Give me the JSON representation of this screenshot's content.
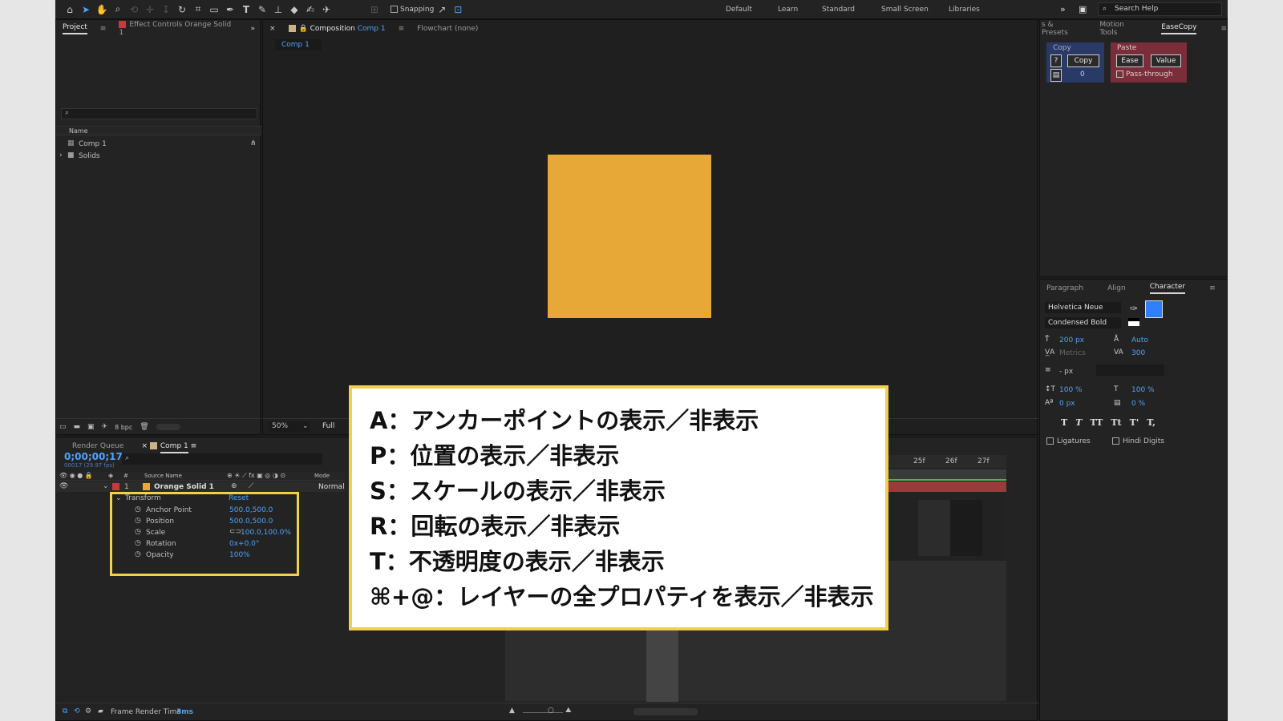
{
  "workspaces": [
    "Default",
    "Learn",
    "Standard",
    "Small Screen",
    "Libraries"
  ],
  "search_help": "Search Help",
  "snapping_label": "Snapping",
  "project_panel": {
    "tab_project": "Project",
    "tab_effect_controls": "Effect Controls Orange Solid 1",
    "column_name": "Name",
    "items": [
      "Comp 1",
      "Solids"
    ],
    "bpc": "8 bpc"
  },
  "comp_panel": {
    "tab_label_prefix": "Composition",
    "tab_label_comp": "Comp 1",
    "flowchart": "Flowchart (none)",
    "subtab": "Comp 1",
    "zoom": "50%",
    "resolution": "Full",
    "solid_color": "#e8a838"
  },
  "right_panel": {
    "tabs": [
      "s & Presets",
      "Motion Tools",
      "EaseCopy"
    ],
    "copy_label": "Copy",
    "copy_button": "Copy",
    "copy_question": "?",
    "copy_count": "0",
    "paste_label": "Paste",
    "ease_button": "Ease",
    "value_button": "Value",
    "pass_through": "Pass-through"
  },
  "character_panel": {
    "tabs": [
      "Paragraph",
      "Align",
      "Character"
    ],
    "font_family": "Helvetica Neue",
    "font_style": "Condensed Bold",
    "font_size": "200 px",
    "leading": "Auto",
    "kerning": "Metrics",
    "tracking": "300",
    "stroke": "- px",
    "vscale": "100 %",
    "hscale": "100 %",
    "baseline": "0 px",
    "tsume": "0 %",
    "style_buttons": [
      "T",
      "T",
      "TT",
      "Tt",
      "T'",
      "T,"
    ],
    "ligatures": "Ligatures",
    "hindi_digits": "Hindi Digits",
    "fill_color": "#2f7fff"
  },
  "timeline": {
    "tab_render_queue": "Render Queue",
    "tab_comp": "Comp 1",
    "timecode": "0;00;00;17",
    "fps_info": "00017 (29.97 fps)",
    "col_source_name": "Source Name",
    "col_mode": "Mode",
    "col_number": "#",
    "layer_number": "1",
    "layer_name": "Orange Solid 1",
    "layer_mode": "Normal",
    "transform_label": "Transform",
    "reset_label": "Reset",
    "properties": [
      {
        "name": "Anchor Point",
        "value": "500.0,500.0"
      },
      {
        "name": "Position",
        "value": "500.0,500.0"
      },
      {
        "name": "Scale",
        "value": "100.0,100.0%"
      },
      {
        "name": "Rotation",
        "value": "0x+0.0°"
      },
      {
        "name": "Opacity",
        "value": "100%"
      }
    ],
    "ruler_marks": [
      "f",
      "25f",
      "26f",
      "27f"
    ],
    "frame_render_label": "Frame Render Time",
    "frame_render_value": "3ms"
  },
  "overlay_lines": [
    "A：アンカーポイントの表示／非表示",
    "P：位置の表示／非表示",
    "S：スケールの表示／非表示",
    "R：回転の表示／非表示",
    "T：不透明度の表示／非表示",
    "⌘+@：レイヤーの全プロパティを表示／非表示"
  ],
  "colors": {
    "accent": "#4da3ff",
    "highlight_border": "#f2d04a",
    "layer_label": "#c63a3a"
  }
}
